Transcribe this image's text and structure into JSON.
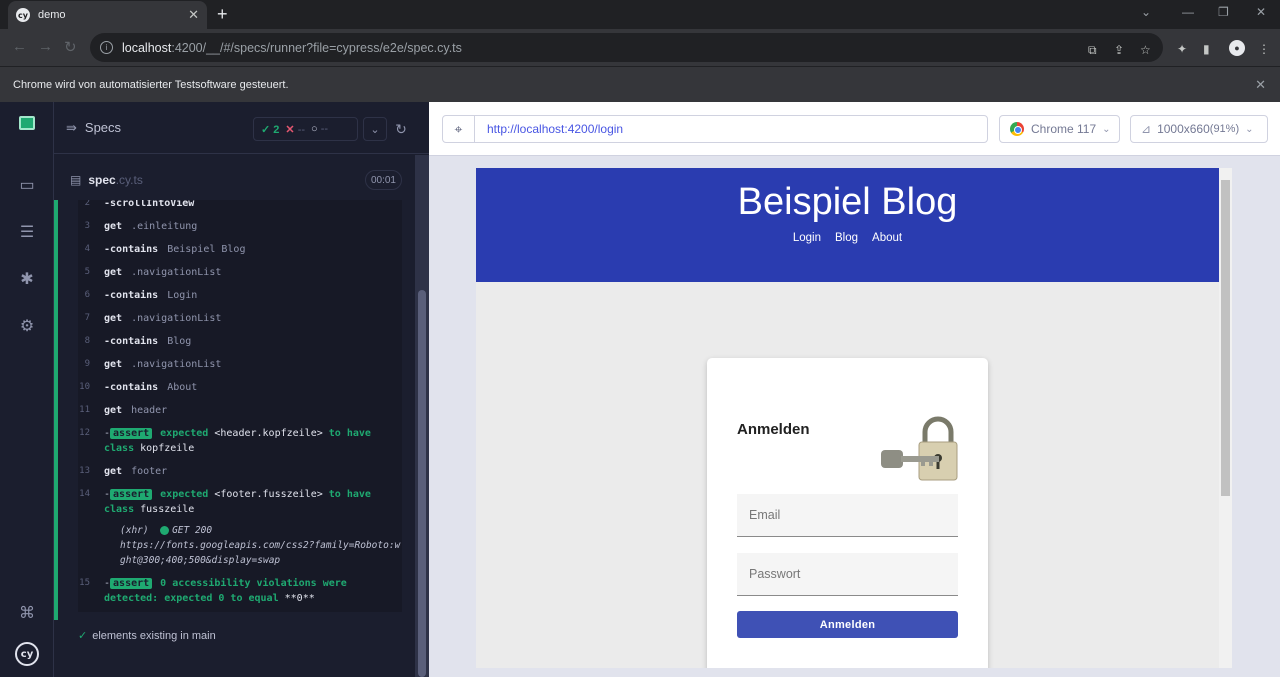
{
  "browser": {
    "tab_title": "demo",
    "address": {
      "host": "localhost",
      "path": ":4200/__/#/specs/runner?file=cypress/e2e/spec.cy.ts"
    },
    "automation_notice": "Chrome wird von automatisierter Testsoftware gesteuert."
  },
  "reporter": {
    "header_label": "Specs",
    "stats": {
      "passed": "2",
      "failed": "--",
      "pending": "--"
    },
    "spec": {
      "name": "spec",
      "ext": ".cy.ts",
      "duration": "00:01"
    },
    "commands": [
      {
        "num": "2",
        "prefix": "-",
        "name": "scrollIntoView",
        "arg": ""
      },
      {
        "num": "3",
        "prefix": "",
        "name": "get",
        "arg": ".einleitung"
      },
      {
        "num": "4",
        "prefix": "-",
        "name": "contains",
        "arg": "Beispiel Blog"
      },
      {
        "num": "5",
        "prefix": "",
        "name": "get",
        "arg": ".navigationList"
      },
      {
        "num": "6",
        "prefix": "-",
        "name": "contains",
        "arg": "Login"
      },
      {
        "num": "7",
        "prefix": "",
        "name": "get",
        "arg": ".navigationList"
      },
      {
        "num": "8",
        "prefix": "-",
        "name": "contains",
        "arg": "Blog"
      },
      {
        "num": "9",
        "prefix": "",
        "name": "get",
        "arg": ".navigationList"
      },
      {
        "num": "10",
        "prefix": "-",
        "name": "contains",
        "arg": "About"
      },
      {
        "num": "11",
        "prefix": "",
        "name": "get",
        "arg": "header"
      }
    ],
    "assert12": {
      "num": "12",
      "badge": "assert",
      "pre": "expected",
      "subject": "<header.kopfzeile>",
      "mid": "to have class",
      "value": "kopfzeile"
    },
    "cmd13": {
      "num": "13",
      "name": "get",
      "arg": "footer"
    },
    "assert14": {
      "num": "14",
      "badge": "assert",
      "pre": "expected",
      "subject": "<footer.fusszeile>",
      "mid": "to have class",
      "value": "fusszeile"
    },
    "xhr": {
      "label": "(xhr)",
      "method": "GET 200",
      "url": "https://fonts.googleapis.com/css2?family=Roboto:wght@300;400;500&display=swap"
    },
    "assert15": {
      "num": "15",
      "badge": "assert",
      "text": "0 accessibility violations were detected: expected 0 to equal",
      "value": "**0**"
    },
    "test_title": "elements existing in main"
  },
  "aut": {
    "url": "http://localhost:4200/login",
    "browser_label": "Chrome 117",
    "viewport_label": "1000x660",
    "viewport_scale": "(91%)"
  },
  "app": {
    "title": "Beispiel Blog",
    "nav": [
      "Login",
      "Blog",
      "About"
    ],
    "card_title": "Anmelden",
    "email_placeholder": "Email",
    "password_placeholder": "Passwort",
    "submit_label": "Anmelden"
  },
  "colors": {
    "cypress_bg": "#1b1e2e",
    "pass_green": "#1fa971",
    "blog_blue": "#2a3cb0",
    "button_indigo": "#3f51b5"
  }
}
